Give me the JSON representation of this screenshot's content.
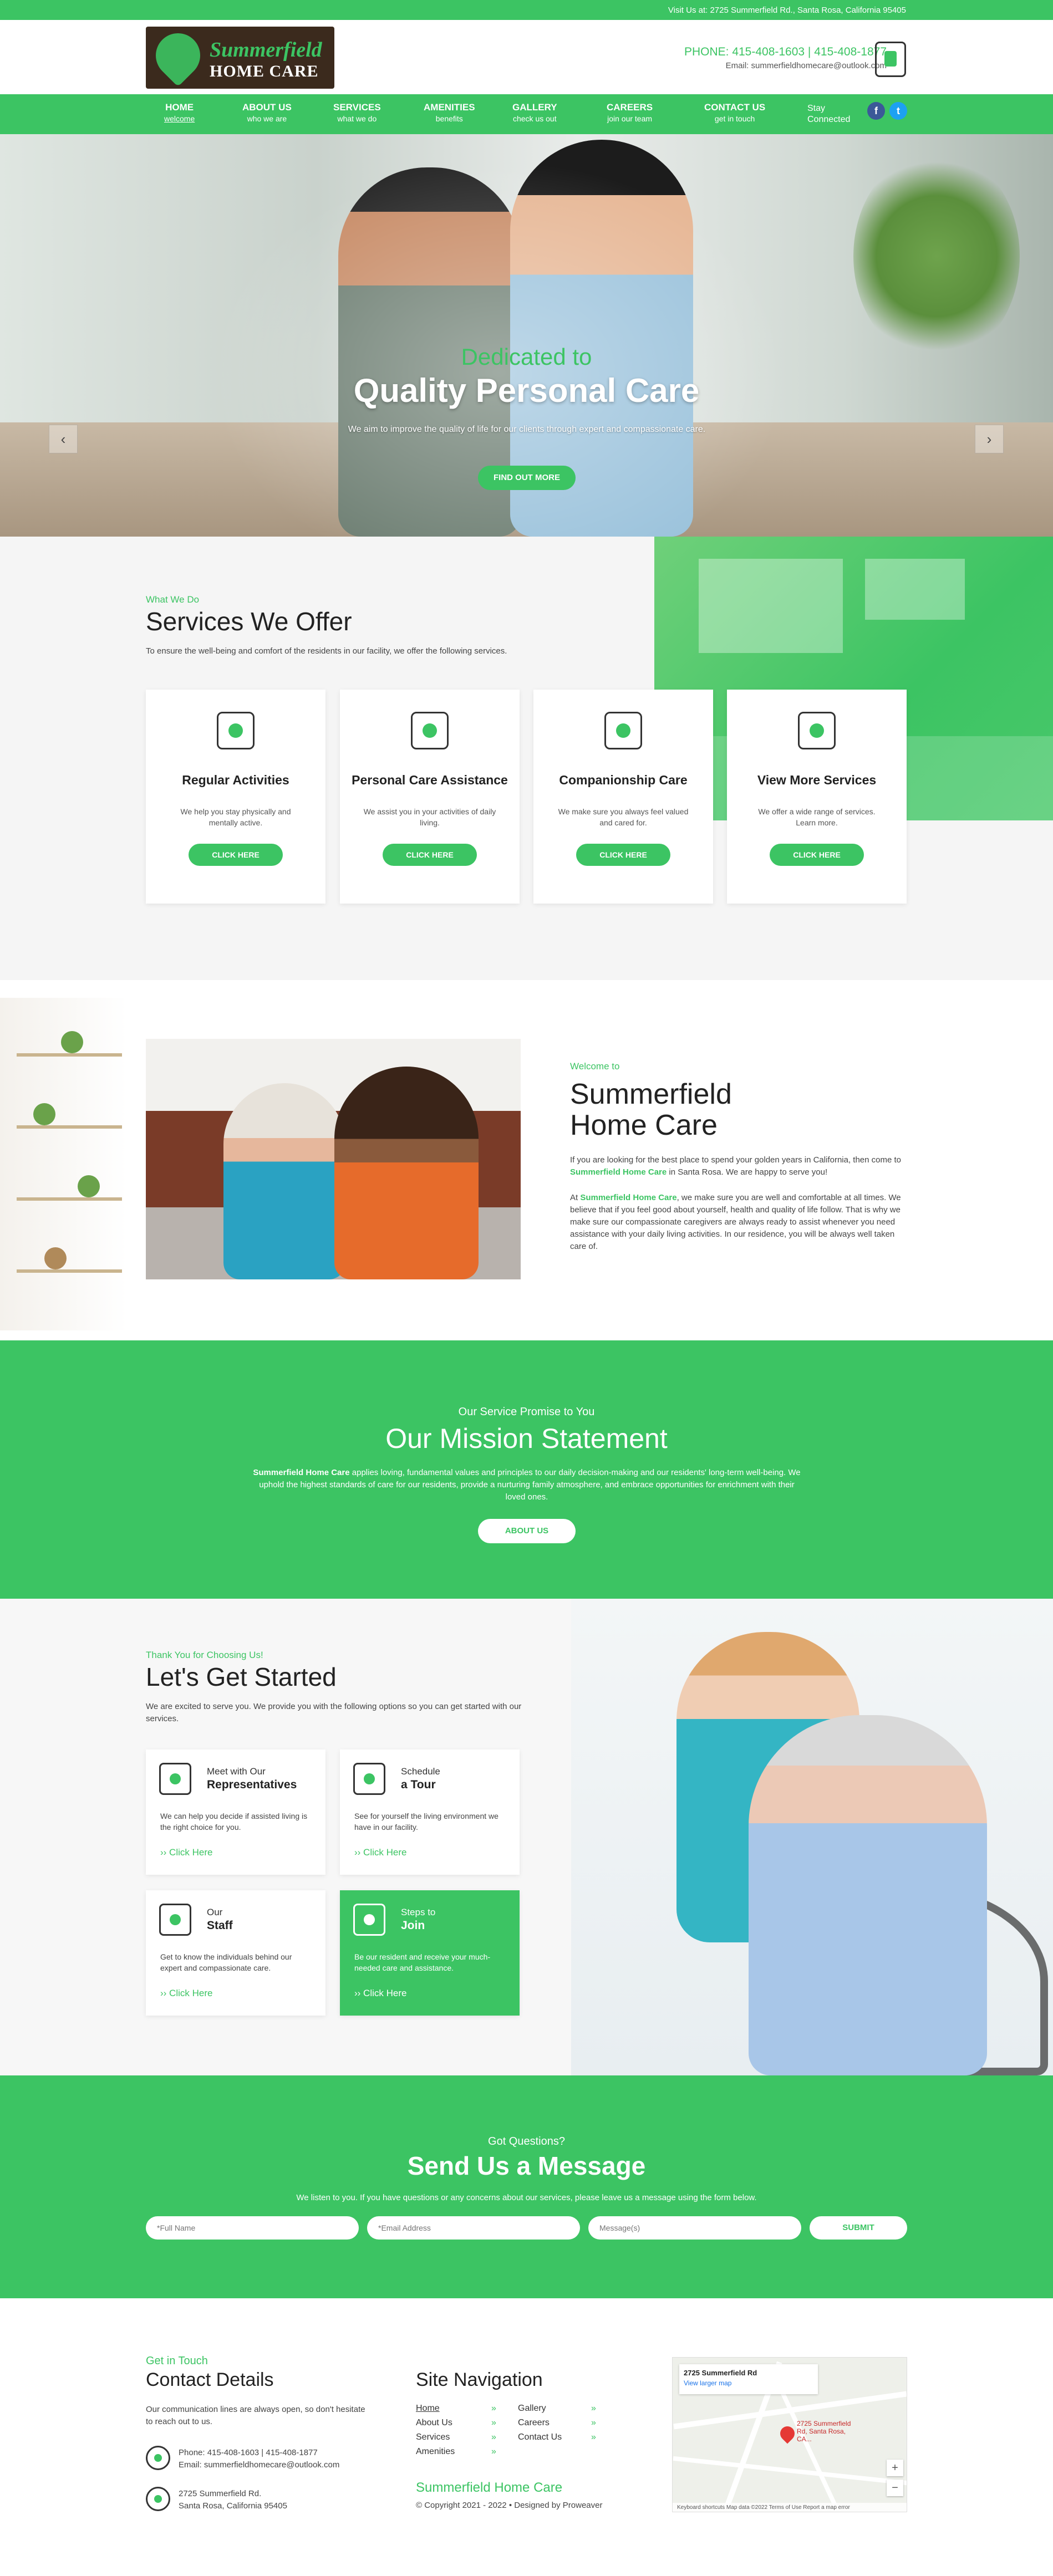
{
  "topbar": {
    "visit": "Visit Us at: 2725 Summerfield Rd., Santa Rosa, California 95405"
  },
  "header": {
    "logo_line1": "Summerfield",
    "logo_line2": "HOME CARE",
    "phone": "PHONE: 415-408-1603 | 415-408-1877",
    "email": "Email: summerfieldhomecare@outlook.com"
  },
  "nav": {
    "items": [
      {
        "label": "HOME",
        "sub": "welcome"
      },
      {
        "label": "ABOUT US",
        "sub": "who we are"
      },
      {
        "label": "SERVICES",
        "sub": "what we do"
      },
      {
        "label": "AMENITIES",
        "sub": "benefits"
      },
      {
        "label": "GALLERY",
        "sub": "check us out"
      },
      {
        "label": "CAREERS",
        "sub": "join our team"
      },
      {
        "label": "CONTACT US",
        "sub": "get in touch"
      }
    ],
    "stay": "Stay",
    "connected": "Connected",
    "facebook": "f",
    "twitter": "t"
  },
  "hero": {
    "sub": "Dedicated to",
    "title": "Quality Personal Care",
    "text": "We aim to improve the quality of life for our clients through expert and compassionate care.",
    "button": "FIND OUT MORE",
    "prev": "‹",
    "next": "›"
  },
  "services": {
    "sub": "What We Do",
    "title": "Services We Offer",
    "text": "To ensure the well-being and comfort of the residents in our facility, we offer the following services.",
    "cards": [
      {
        "title": "Regular Activities",
        "text": "We help you stay physically and mentally active.",
        "button": "CLICK HERE",
        "icon": "activities-icon"
      },
      {
        "title": "Personal Care Assistance",
        "text": "We assist you in your activities of daily living.",
        "button": "CLICK HERE",
        "icon": "personal-care-icon"
      },
      {
        "title": "Companionship Care",
        "text": "We make sure you always feel valued and cared for.",
        "button": "CLICK HERE",
        "icon": "companionship-icon"
      },
      {
        "title": "View More Services",
        "text": "We offer a wide range of services. Learn more.",
        "button": "CLICK HERE",
        "icon": "more-services-icon"
      }
    ]
  },
  "welcome": {
    "sub": "Welcome to",
    "title_1": "Summerfield",
    "title_2": "Home Care",
    "p1_a": "If you are looking for the best place to spend your golden years in California, then come to ",
    "p1_hl": "Summerfield Home Care",
    "p1_b": " in Santa Rosa. We are happy to serve you!",
    "p2_a": "At ",
    "p2_hl": "Summerfield Home Care",
    "p2_b": ", we make sure you are well and comfortable at all times. We believe that if you feel good about yourself, health and quality of life follow. That is why we make sure our compassionate caregivers are always ready to assist whenever you need assistance with your daily living activities. In our residence, you will be always well taken care of."
  },
  "mission": {
    "sub": "Our Service Promise to You",
    "title": "Our Mission Statement",
    "text_hl": "Summerfield Home Care",
    "text": " applies loving, fundamental values and principles to our daily decision-making and our residents' long-term well-being. We uphold the highest standards of care for our residents, provide a nurturing family atmosphere, and embrace opportunities for enrichment with their loved ones.",
    "button": "ABOUT US"
  },
  "started": {
    "sub": "Thank You for Choosing Us!",
    "title": "Let's Get Started",
    "text": "We are excited to serve you. We provide you with the following options so you can get started with our services.",
    "boxes": [
      {
        "h1": "Meet with Our",
        "h2": "Representatives",
        "text": "We can help you decide if assisted living is the right choice for you.",
        "link": "›› Click Here"
      },
      {
        "h1": "Schedule",
        "h2": "a Tour",
        "text": "See for yourself the living environment we have in our facility.",
        "link": "›› Click Here"
      },
      {
        "h1": "Our",
        "h2": "Staff",
        "text": "Get to know the individuals behind our expert and compassionate care.",
        "link": "›› Click Here"
      },
      {
        "h1": "Steps to",
        "h2": "Join",
        "text": "Be our resident and receive your much-needed care and assistance.",
        "link": "›› Click Here"
      }
    ]
  },
  "message": {
    "sub": "Got Questions?",
    "title": "Send Us a Message",
    "text": "We listen to you. If you have questions or any concerns about our services, please leave us a message using the form below.",
    "name_ph": "*Full Name",
    "email_ph": "*Email Address",
    "msg_ph": "Message(s)",
    "button": "SUBMIT"
  },
  "footer": {
    "sub": "Get in Touch",
    "title": "Contact Details",
    "text": "Our communication lines are always open, so don't hesitate to reach out to us.",
    "phone": "Phone: 415-408-1603 | 415-408-1877",
    "email": "Email: summerfieldhomecare@outlook.com",
    "addr1": "2725 Summerfield Rd.",
    "addr2": "Santa Rosa, California 95405",
    "nav_title": "Site Navigation",
    "nav_left": [
      "Home",
      "About Us",
      "Services",
      "Amenities"
    ],
    "nav_right": [
      "Gallery",
      "Careers",
      "Contact Us"
    ],
    "brand": "Summerfield Home Care",
    "copyright": "© Copyright 2021 - 2022 • Designed by Proweaver"
  },
  "map": {
    "place": "2725 Summerfield Rd",
    "larger": "View larger map",
    "pin_label": "2725 Summerfield Rd, Santa Rosa, CA...",
    "zoom_in": "+",
    "zoom_out": "−",
    "footer": "Keyboard shortcuts   Map data ©2022   Terms of Use   Report a map error"
  },
  "colors": {
    "accent": "#3cc463",
    "logo_bg": "#3b2a1d"
  }
}
